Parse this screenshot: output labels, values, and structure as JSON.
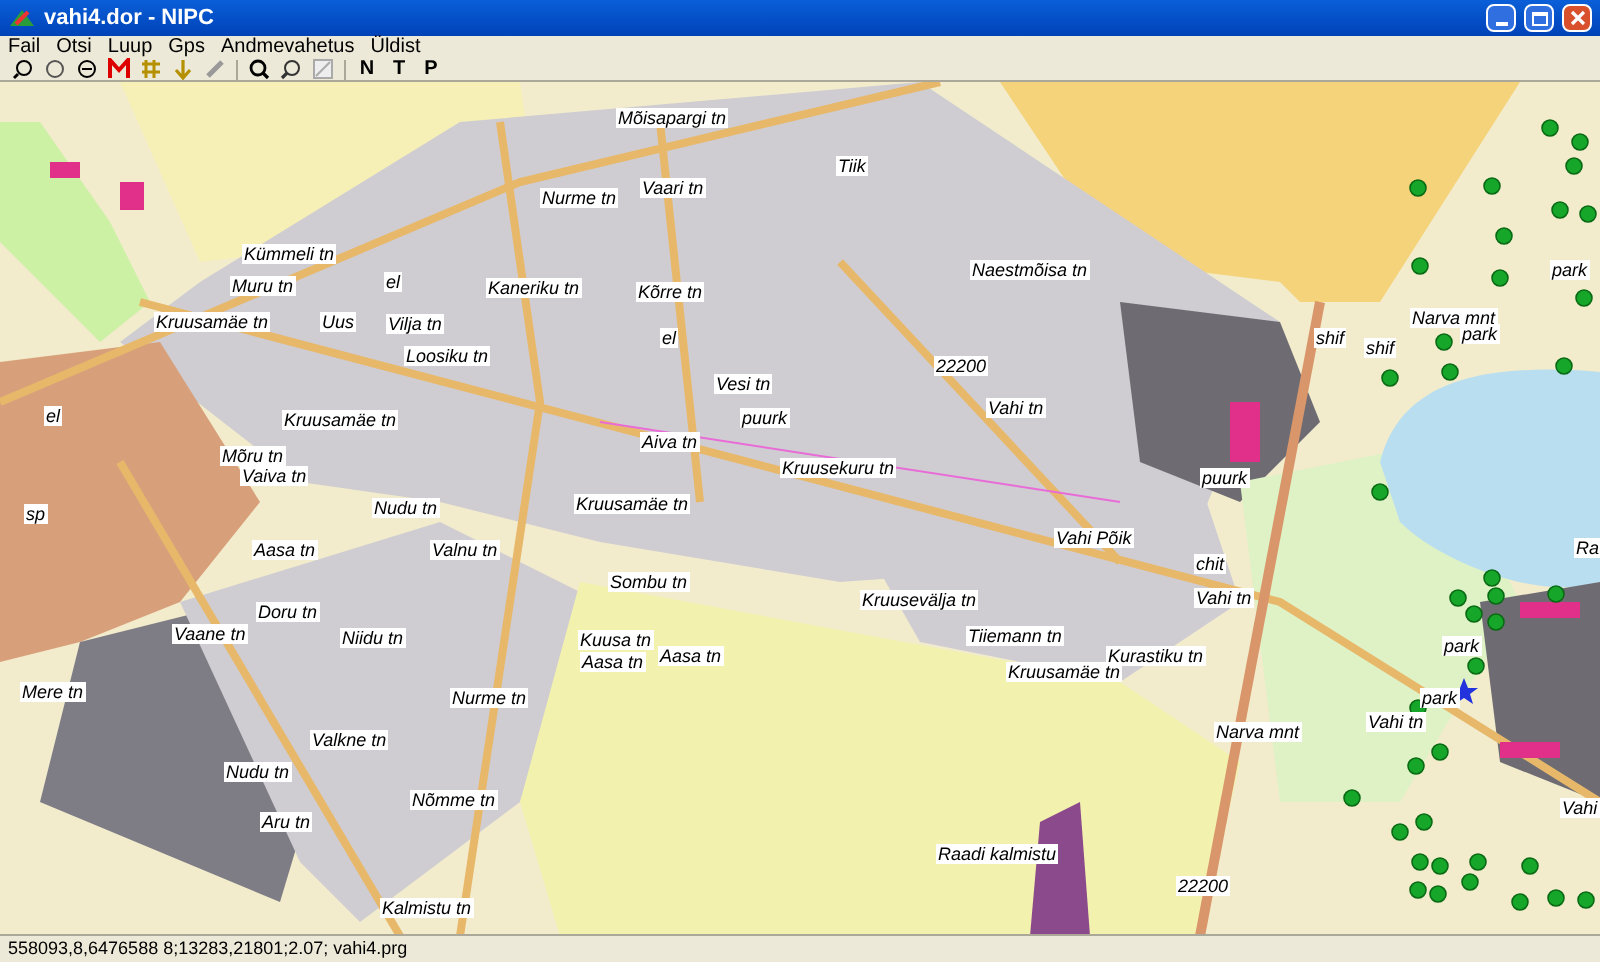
{
  "window": {
    "title": "vahi4.dor - NIPC"
  },
  "menu": [
    "Fail",
    "Otsi",
    "Luup",
    "Gps",
    "Andmevahetus",
    "Üldist"
  ],
  "toolbar": {
    "text_buttons": [
      "N",
      "T",
      "P"
    ]
  },
  "map": {
    "labels": [
      {
        "text": "Mõisapargi tn"
      },
      {
        "text": "Nurme tn"
      },
      {
        "text": "Vaari tn"
      },
      {
        "text": "Kümmeli tn"
      },
      {
        "text": "Muru tn"
      },
      {
        "text": "Kaneriku tn"
      },
      {
        "text": "Kõrre tn"
      },
      {
        "text": "el"
      },
      {
        "text": "Kruusamäe tn"
      },
      {
        "text": "Uus"
      },
      {
        "text": "Vilja tn"
      },
      {
        "text": "Loosiku tn"
      },
      {
        "text": "el"
      },
      {
        "text": "Vesi tn"
      },
      {
        "text": "el"
      },
      {
        "text": "Kruusamäe tn"
      },
      {
        "text": "puurk"
      },
      {
        "text": "Aiva tn"
      },
      {
        "text": "Mõru tn"
      },
      {
        "text": "Vaiva tn"
      },
      {
        "text": "Nudu tn"
      },
      {
        "text": "Kruusamäe tn"
      },
      {
        "text": "Kruusekuru tn"
      },
      {
        "text": "Tiik"
      },
      {
        "text": "Naestmõisa tn"
      },
      {
        "text": "22200"
      },
      {
        "text": "Vahi tn"
      },
      {
        "text": "puurk"
      },
      {
        "text": "shif"
      },
      {
        "text": "shif"
      },
      {
        "text": "Narva mnt"
      },
      {
        "text": "park"
      },
      {
        "text": "park"
      },
      {
        "text": "sp"
      },
      {
        "text": "Aasa tn"
      },
      {
        "text": "Valnu tn"
      },
      {
        "text": "Sombu tn"
      },
      {
        "text": "Doru tn"
      },
      {
        "text": "Vaane tn"
      },
      {
        "text": "Niidu tn"
      },
      {
        "text": "Kuusa tn"
      },
      {
        "text": "Aasa tn"
      },
      {
        "text": "Aasa tn"
      },
      {
        "text": "Mere tn"
      },
      {
        "text": "Nurme tn"
      },
      {
        "text": "Valkne tn"
      },
      {
        "text": "Nudu tn"
      },
      {
        "text": "Nõmme tn"
      },
      {
        "text": "Aru tn"
      },
      {
        "text": "Kalmistu tn"
      },
      {
        "text": "Vahi Põik"
      },
      {
        "text": "chit"
      },
      {
        "text": "Kruusevälja tn"
      },
      {
        "text": "Vahi tn"
      },
      {
        "text": "Tiiemann tn"
      },
      {
        "text": "Kurastiku tn"
      },
      {
        "text": "Kruusamäe tn"
      },
      {
        "text": "Narva mnt"
      },
      {
        "text": "Vahi tn"
      },
      {
        "text": "park"
      },
      {
        "text": "park"
      },
      {
        "text": "Raadi kalmistu"
      },
      {
        "text": "22200"
      },
      {
        "text": "Ra"
      },
      {
        "text": "Vahi"
      }
    ]
  },
  "status_bar": {
    "text": "558093,8,6476588 8;13283,21801;2.07; vahi4.prg"
  }
}
